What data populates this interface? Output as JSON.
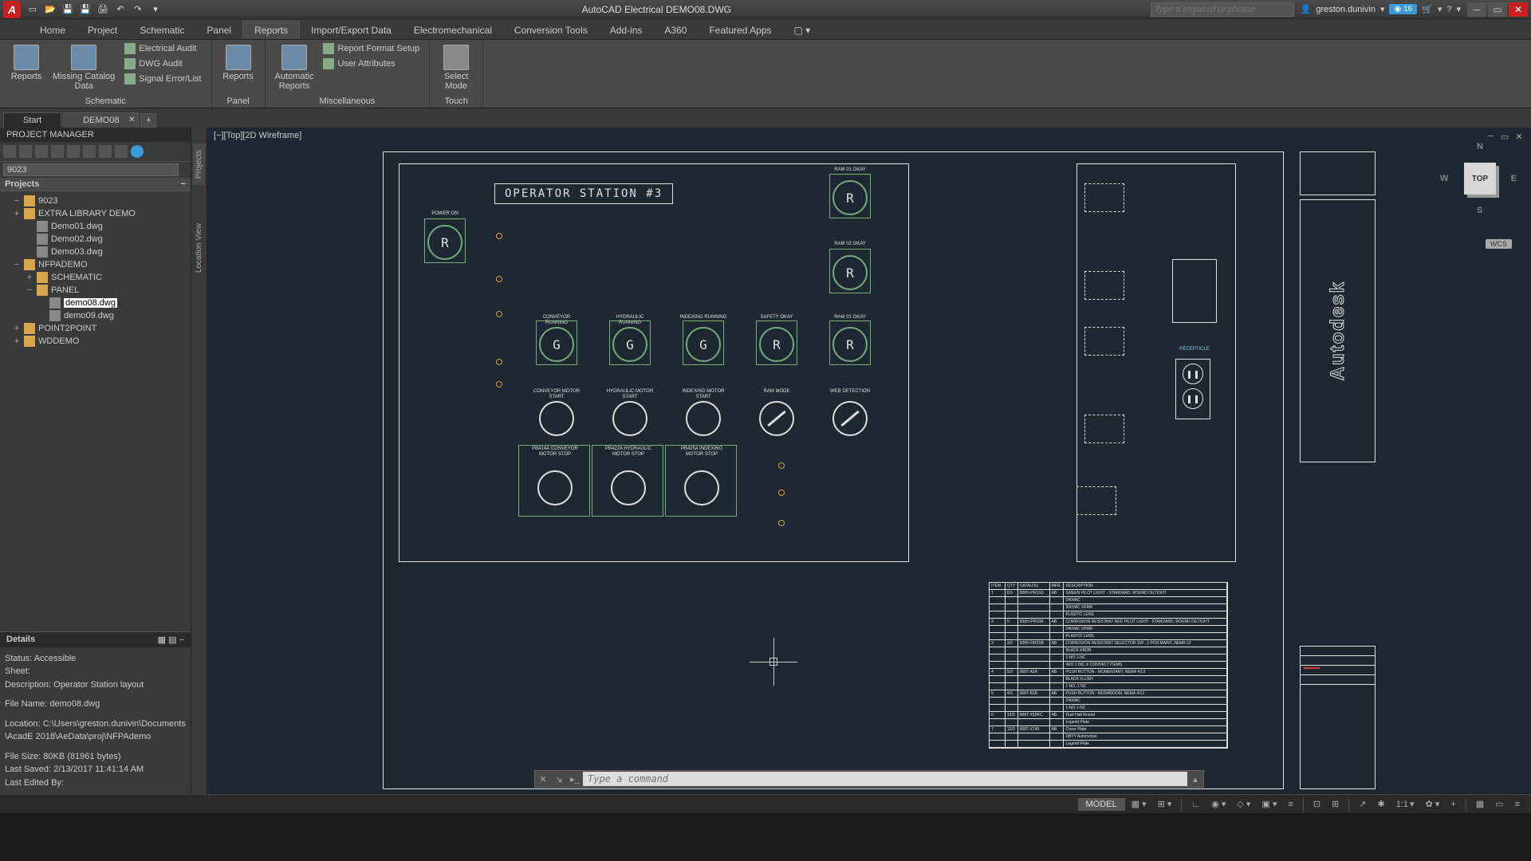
{
  "title": "AutoCAD Electrical   DEMO08.DWG",
  "search_placeholder": "Type a keyword or phrase",
  "user": "greston.dunivin",
  "notif_count": "16",
  "ribbon_tabs": [
    "Home",
    "Project",
    "Schematic",
    "Panel",
    "Reports",
    "Import/Export Data",
    "Electromechanical",
    "Conversion Tools",
    "Add-ins",
    "A360",
    "Featured Apps"
  ],
  "active_ribbon_tab": 4,
  "ribbon": {
    "schematic": {
      "label": "Schematic",
      "reports": "Reports",
      "missing_catalog": "Missing Catalog\nData",
      "electrical_audit": "Electrical Audit",
      "dwg_audit": "DWG Audit",
      "signal_error": "Signal Error/List"
    },
    "panel": {
      "label": "Panel",
      "reports": "Reports"
    },
    "misc": {
      "label": "Miscellaneous",
      "auto_reports": "Automatic\nReports",
      "report_format": "Report Format Setup",
      "user_attrs": "User Attributes"
    },
    "touch": {
      "label": "Touch",
      "select_mode": "Select\nMode"
    }
  },
  "doc_tabs": [
    "Start",
    "DEMO08"
  ],
  "active_doc_tab": 1,
  "project_manager": {
    "title": "PROJECT MANAGER",
    "combo": "9023",
    "projects_label": "Projects",
    "tree": [
      {
        "level": 1,
        "toggle": "−",
        "icon": "folder",
        "label": "9023"
      },
      {
        "level": 1,
        "toggle": "+",
        "icon": "folder",
        "label": "EXTRA LIBRARY DEMO"
      },
      {
        "level": 2,
        "toggle": "",
        "icon": "file",
        "label": "Demo01.dwg"
      },
      {
        "level": 2,
        "toggle": "",
        "icon": "file",
        "label": "Demo02.dwg"
      },
      {
        "level": 2,
        "toggle": "",
        "icon": "file",
        "label": "Demo03.dwg"
      },
      {
        "level": 1,
        "toggle": "−",
        "icon": "folder",
        "label": "NFPADEMO"
      },
      {
        "level": 2,
        "toggle": "+",
        "icon": "folder",
        "label": "SCHEMATIC"
      },
      {
        "level": 2,
        "toggle": "−",
        "icon": "folder",
        "label": "PANEL"
      },
      {
        "level": 3,
        "toggle": "",
        "icon": "file",
        "label": "demo08.dwg",
        "selected": true
      },
      {
        "level": 3,
        "toggle": "",
        "icon": "file",
        "label": "demo09.dwg"
      },
      {
        "level": 1,
        "toggle": "+",
        "icon": "folder",
        "label": "POINT2POINT"
      },
      {
        "level": 1,
        "toggle": "+",
        "icon": "folder",
        "label": "WDDEMO"
      }
    ]
  },
  "details": {
    "title": "Details",
    "status": "Status: Accessible",
    "sheet": "Sheet:",
    "description": "Description: Operator Station layout",
    "filename": "File Name: demo08.dwg",
    "location": "Location: C:\\Users\\greston.dunivin\\Documents\\AcadE 2018\\AeData\\proj\\NFPAdemo",
    "filesize": "File Size: 80KB (81961 bytes)",
    "lastsaved": "Last Saved: 2/13/2017 11:41:14 AM",
    "lastedited": "Last Edited By:"
  },
  "vert_tabs": [
    "Projects",
    "Location View"
  ],
  "canvas": {
    "view_label": "[−][Top][2D Wireframe]",
    "station_title": "OPERATOR  STATION  #3",
    "viewcube": {
      "face": "TOP",
      "n": "N",
      "e": "E",
      "s": "S",
      "w": "W",
      "wcs": "WCS"
    },
    "autodesk": "Autodesk",
    "lights": {
      "power_on": "POWER\nON",
      "ram01": "RAM 01\nOKAY",
      "ram02": "RAM 02\nOKAY",
      "conveyor_running": "CONVEYOR RUNNING",
      "hydraulic_running": "HYDRAULIC RUNNING",
      "indexing_running": "INDEXING RUNNING",
      "safety_okay": "SAFETY\nOKAY",
      "ram01b": "RAM 01\nOKAY",
      "conveyor_start": "CONVEYOR MOTOR\nSTART",
      "hydraulic_start": "HYDRAULIC MOTOR\nSTART",
      "indexing_start": "INDEXING MOTOR\nSTART",
      "ram_mode": "RAM\nMODE",
      "web_detection": "WEB  DETECTION",
      "stop1": "PB414A\nCONVEYOR MOTOR\nSTOP",
      "stop2": "PB422A\nHYDRAULIC MOTOR\nSTOP",
      "stop3": "PB425A\nINDEXING MOTOR\nSTOP"
    },
    "receptacle_label": "RECEPTICLE",
    "bom_headers": [
      "ITEM",
      "QTY",
      "CATALOG",
      "MFG",
      "DESCRIPTION"
    ],
    "bom_rows": [
      [
        "1",
        "6/3",
        "800H-PR16G",
        "AB",
        "GREEN PILOT LIGHT - STANDARD, ROUND OILTIGHT"
      ],
      [
        "",
        "",
        "",
        "",
        "240VAC"
      ],
      [
        "",
        "",
        "",
        "",
        "300VAC XFMR"
      ],
      [
        "",
        "",
        "",
        "",
        "PLASTIC LENS"
      ],
      [
        "2",
        "5",
        "800H-PR16R",
        "AB",
        "CORROSION RESISTANT RED PILOT LIGHT - STANDARD, ROUND OILTIGHT"
      ],
      [
        "",
        "",
        "",
        "",
        "240VAC XFMR"
      ],
      [
        "",
        "",
        "",
        "",
        "PLASTIC LENS"
      ],
      [
        "3",
        "3/2",
        "800H-HR2SB",
        "AB",
        "CORROSION RESISTANT SELECTOR SW - 2 POS MAINT, NEMA 13"
      ],
      [
        "",
        "",
        "",
        "",
        "BLACK KNOB"
      ],
      [
        "",
        "",
        "",
        "",
        "1-NO 1-NC"
      ],
      [
        "",
        "",
        "",
        "",
        "W/O 1 INC X CONTACT ITEMS"
      ],
      [
        "4",
        "5/3",
        "800T-A2A",
        "AB",
        "PUSH BUTTON - MOMENTARY, NEMA 4/13"
      ],
      [
        "",
        "",
        "",
        "",
        "BLACK FLUSH"
      ],
      [
        "",
        "",
        "",
        "",
        "1 NO, 1 NC"
      ],
      [
        "5",
        "4/3",
        "800T-B1B",
        "AB",
        "PUSH BUTTON - MUSHROOM, NEMA 4/13"
      ],
      [
        "",
        "",
        "",
        "",
        "240VAC"
      ],
      [
        "",
        "",
        "",
        "",
        "1-NO 1-NC"
      ],
      [
        "6",
        "12/3",
        "800T-X59KC",
        "AB",
        "Dust Halt Round"
      ],
      [
        "",
        "",
        "",
        "",
        "Legend Plate"
      ],
      [
        "7",
        "12/3",
        "800T-X745",
        "AB",
        "Cover Plate"
      ],
      [
        "",
        "",
        "",
        "",
        "XBYY Automotive"
      ],
      [
        "",
        "",
        "",
        "",
        "Legend Plate"
      ]
    ]
  },
  "cmdline_placeholder": "Type a command",
  "status": {
    "model": "MODEL",
    "scale": "1:1"
  }
}
